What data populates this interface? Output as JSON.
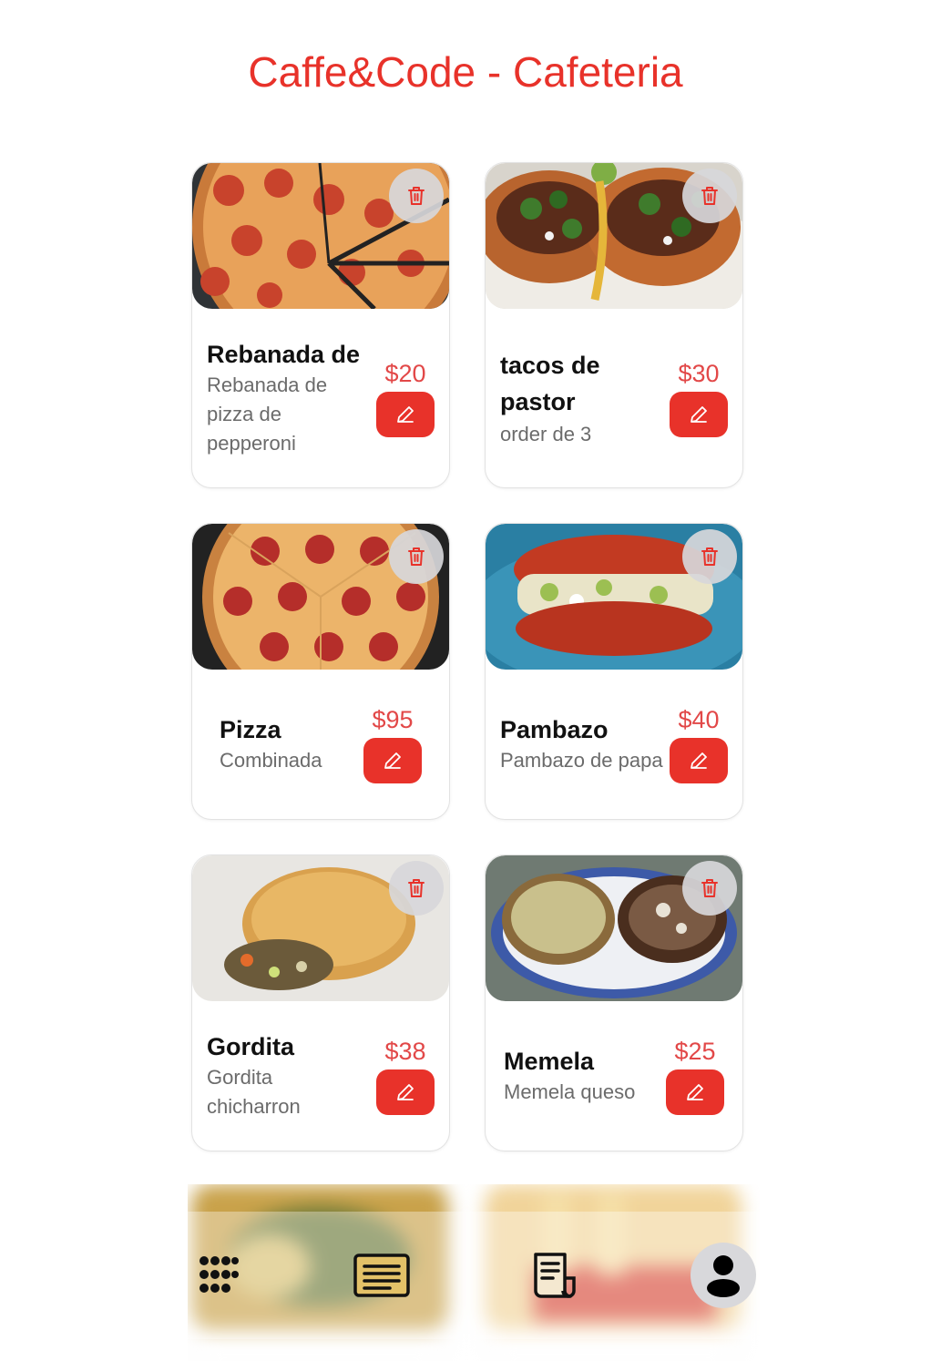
{
  "header": {
    "title": "Caffe&Code - Cafeteria"
  },
  "products": [
    {
      "name": "Rebanada de",
      "description": "Rebanada de pizza de pepperoni",
      "price": "$20",
      "image": "pepperoni-slices-photo"
    },
    {
      "name": "tacos de pastor",
      "description": "order de 3",
      "price": "$30",
      "image": "tacos-photo"
    },
    {
      "name": "Pizza",
      "description": "Combinada",
      "price": "$95",
      "image": "pepperoni-pizza-photo"
    },
    {
      "name": "Pambazo",
      "description": "Pambazo de papa",
      "price": "$40",
      "image": "pambazo-photo"
    },
    {
      "name": "Gordita",
      "description": "Gordita chicharron",
      "price": "$38",
      "image": "gordita-photo"
    },
    {
      "name": "Memela",
      "description": "Memela queso",
      "price": "$25",
      "image": "memela-photo"
    }
  ],
  "icons": {
    "delete": "trash-icon",
    "edit": "pencil-icon",
    "nav": [
      "grid-dots-icon",
      "menu-list-icon",
      "receipt-icon",
      "user-avatar-icon"
    ]
  },
  "colors": {
    "accent": "#e8322a",
    "price": "#e24848",
    "delete_bg": "#d7d7da"
  }
}
